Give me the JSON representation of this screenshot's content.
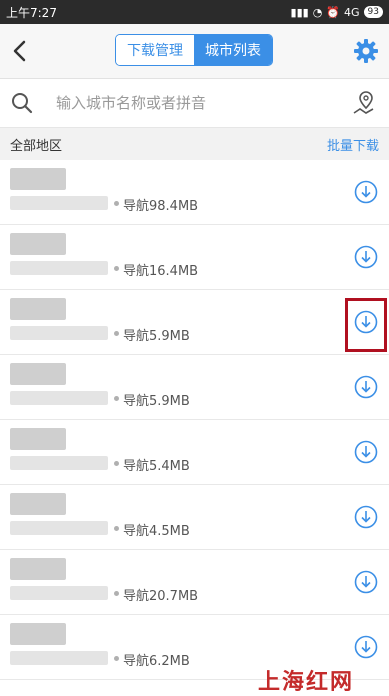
{
  "status_bar": {
    "time": "上午7:27",
    "network": "4G",
    "battery": "93"
  },
  "header": {
    "back_icon": "chevron-left-icon",
    "tabs": [
      {
        "label": "下载管理",
        "active": false
      },
      {
        "label": "城市列表",
        "active": true
      }
    ],
    "settings_icon": "gear-icon",
    "accent_color": "#3b8fe6"
  },
  "search": {
    "placeholder": "输入城市名称或者拼音",
    "value": "",
    "locate_icon": "map-pin-icon"
  },
  "section": {
    "title": "全部地区",
    "action": "批量下载"
  },
  "cities": [
    {
      "size": "导航98.4MB"
    },
    {
      "size": "导航16.4MB"
    },
    {
      "size": "导航5.9MB",
      "highlighted": true
    },
    {
      "size": "导航5.9MB"
    },
    {
      "size": "导航5.4MB"
    },
    {
      "size": "导航4.5MB"
    },
    {
      "size": "导航20.7MB"
    },
    {
      "size": "导航6.2MB"
    }
  ],
  "watermark": "上海红网"
}
